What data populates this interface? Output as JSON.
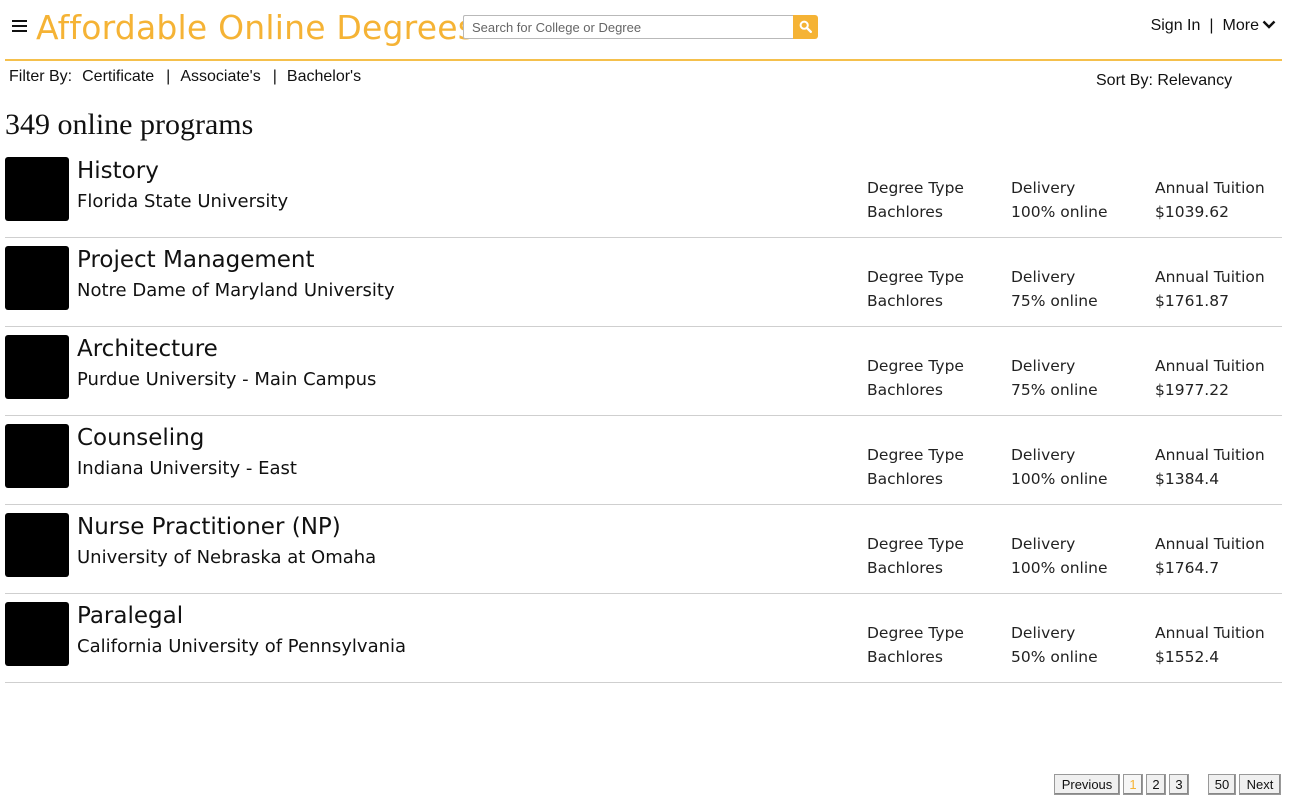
{
  "header": {
    "brand": "Affordable Online Degrees",
    "search_placeholder": "Search for College or Degree",
    "sign_in": "Sign In",
    "separator": "|",
    "more": "More",
    "accent_color": "#f5b335"
  },
  "filter": {
    "label": "Filter By:",
    "items": [
      "Certificate",
      "Associate's",
      "Bachelor's"
    ],
    "separator": "|"
  },
  "sort": {
    "label": "Sort By:",
    "value": "Relevancy"
  },
  "results": {
    "heading": "349 online programs"
  },
  "programs": [
    {
      "title": "History",
      "school": "Florida State University",
      "degree_label": "Degree Type",
      "degree": "Bachlores",
      "delivery_label": "Delivery",
      "delivery": "100% online",
      "tuition_label": "Annual Tuition",
      "tuition": "$1039.62"
    },
    {
      "title": "Project Management",
      "school": "Notre Dame of Maryland University",
      "degree_label": "Degree Type",
      "degree": "Bachlores",
      "delivery_label": "Delivery",
      "delivery": "75% online",
      "tuition_label": "Annual Tuition",
      "tuition": "$1761.87"
    },
    {
      "title": "Architecture",
      "school": "Purdue University - Main Campus",
      "degree_label": "Degree Type",
      "degree": "Bachlores",
      "delivery_label": "Delivery",
      "delivery": "75% online",
      "tuition_label": "Annual Tuition",
      "tuition": "$1977.22"
    },
    {
      "title": "Counseling",
      "school": "Indiana University - East",
      "degree_label": "Degree Type",
      "degree": "Bachlores",
      "delivery_label": "Delivery",
      "delivery": "100% online",
      "tuition_label": "Annual Tuition",
      "tuition": "$1384.4"
    },
    {
      "title": "Nurse Practitioner (NP)",
      "school": "University of Nebraska at Omaha",
      "degree_label": "Degree Type",
      "degree": "Bachlores",
      "delivery_label": "Delivery",
      "delivery": "100% online",
      "tuition_label": "Annual Tuition",
      "tuition": "$1764.7"
    },
    {
      "title": "Paralegal",
      "school": "California University of Pennsylvania",
      "degree_label": "Degree Type",
      "degree": "Bachlores",
      "delivery_label": "Delivery",
      "delivery": "50% online",
      "tuition_label": "Annual Tuition",
      "tuition": "$1552.4"
    }
  ],
  "pagination": {
    "previous": "Previous",
    "pages": [
      "1",
      "2",
      "3"
    ],
    "current": "1",
    "last": "50",
    "next": "Next"
  }
}
